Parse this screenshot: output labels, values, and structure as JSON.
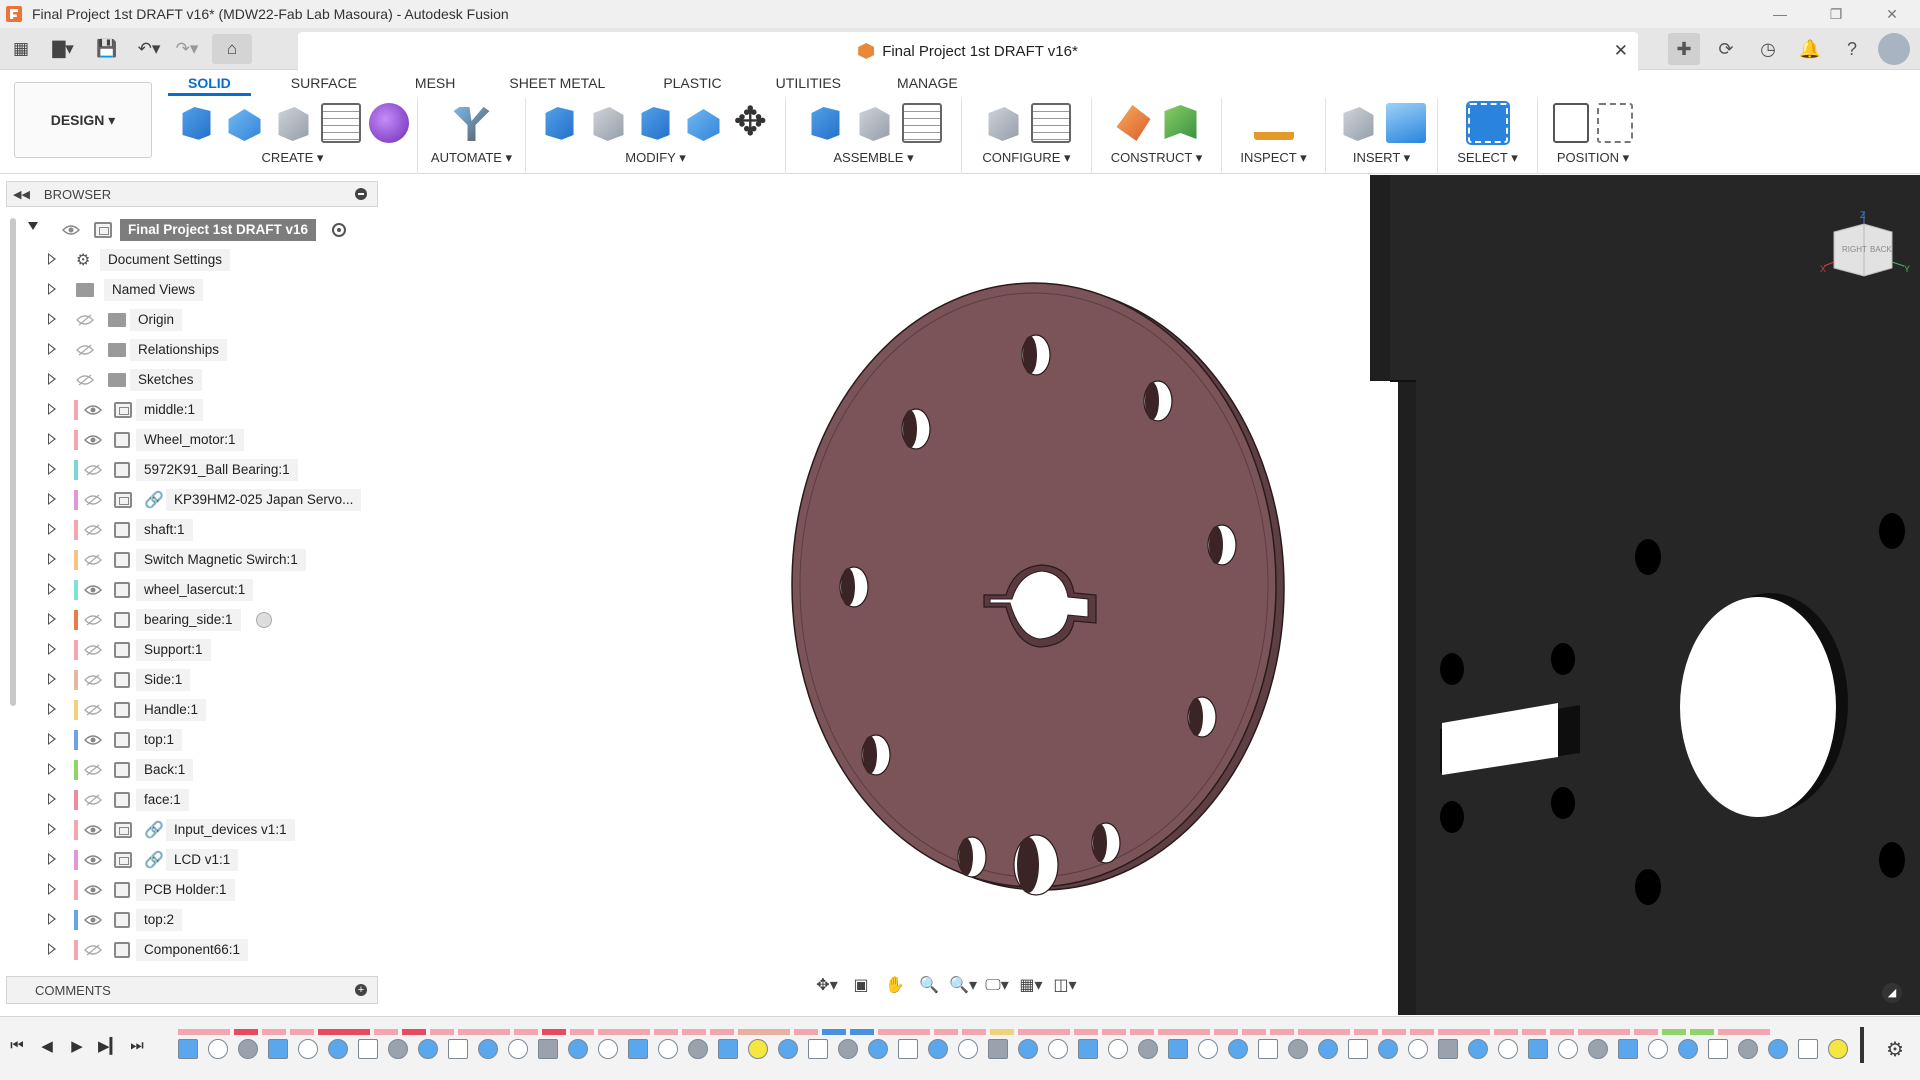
{
  "window": {
    "title": "Final Project 1st DRAFT v16* (MDW22-Fab Lab Masoura) - Autodesk Fusion",
    "controls": [
      "minimize-icon",
      "restore-icon",
      "close-icon"
    ]
  },
  "document_tab": {
    "title": "Final Project 1st DRAFT v16*",
    "close_glyph": "✕"
  },
  "ribbon": {
    "workspace_label": "DESIGN ▾",
    "tabs": [
      "SOLID",
      "SURFACE",
      "MESH",
      "SHEET METAL",
      "PLASTIC",
      "UTILITIES",
      "MANAGE"
    ],
    "active_tab": "SOLID",
    "groups": [
      {
        "label": "CREATE ▾",
        "icons": [
          "new-component-icon",
          "extrude-icon",
          "revolve-icon",
          "sketch-dimension-icon",
          "form-icon"
        ]
      },
      {
        "label": "AUTOMATE ▾",
        "icons": [
          "automate-icon"
        ]
      },
      {
        "label": "MODIFY ▾",
        "icons": [
          "press-pull-icon",
          "fillet-icon",
          "combine-icon",
          "offset-face-icon",
          "move-icon"
        ]
      },
      {
        "label": "ASSEMBLE ▾",
        "icons": [
          "new-component-icon",
          "joint-icon",
          "bom-icon"
        ]
      },
      {
        "label": "CONFIGURE ▾",
        "icons": [
          "configure-icon",
          "table-icon"
        ]
      },
      {
        "label": "CONSTRUCT ▾",
        "icons": [
          "offset-plane-icon",
          "midplane-icon"
        ]
      },
      {
        "label": "INSPECT ▾",
        "icons": [
          "measure-icon"
        ]
      },
      {
        "label": "INSERT ▾",
        "icons": [
          "insert-derive-icon",
          "insert-image-icon"
        ]
      },
      {
        "label": "SELECT ▾",
        "icons": [
          "select-icon"
        ]
      },
      {
        "label": "POSITION ▾",
        "icons": [
          "capture-position-icon",
          "revert-position-icon"
        ]
      }
    ]
  },
  "browser": {
    "title": "BROWSER",
    "root": {
      "label": "Final Project 1st DRAFT v16"
    },
    "items": [
      {
        "label": "Document Settings",
        "kind": "settings",
        "color": null,
        "visible": null
      },
      {
        "label": "Named Views",
        "kind": "folder",
        "color": null,
        "visible": null
      },
      {
        "label": "Origin",
        "kind": "folder",
        "color": null,
        "visible": false
      },
      {
        "label": "Relationships",
        "kind": "folder",
        "color": null,
        "visible": false
      },
      {
        "label": "Sketches",
        "kind": "folder",
        "color": null,
        "visible": false
      },
      {
        "label": "middle:1",
        "kind": "component-assembly",
        "color": "#f4a6b0",
        "visible": true
      },
      {
        "label": "Wheel_motor:1",
        "kind": "component",
        "color": "#f4a6b0",
        "visible": true
      },
      {
        "label": "5972K91_Ball Bearing:1",
        "kind": "component",
        "color": "#7fd6d0",
        "visible": false
      },
      {
        "label": "KP39HM2-025 Japan Servo...",
        "kind": "component-linked",
        "color": "#e596d6",
        "visible": false
      },
      {
        "label": "shaft:1",
        "kind": "component",
        "color": "#f4a6b0",
        "visible": false
      },
      {
        "label": "Switch Magnetic Swirch:1",
        "kind": "component",
        "color": "#f5c28a",
        "visible": false
      },
      {
        "label": "wheel_lasercut:1",
        "kind": "component",
        "color": "#7fe0d8",
        "visible": true
      },
      {
        "label": "bearing_side:1",
        "kind": "component",
        "color": "#ea7b4e",
        "visible": false,
        "radio": true
      },
      {
        "label": "Support:1",
        "kind": "component",
        "color": "#f4a6b0",
        "visible": false
      },
      {
        "label": "Side:1",
        "kind": "component",
        "color": "#e8b8a0",
        "visible": false
      },
      {
        "label": "Handle:1",
        "kind": "component",
        "color": "#f0d27a",
        "visible": false
      },
      {
        "label": "top:1",
        "kind": "component",
        "color": "#6aa3e6",
        "visible": true
      },
      {
        "label": "Back:1",
        "kind": "component",
        "color": "#8fd46a",
        "visible": false
      },
      {
        "label": "face:1",
        "kind": "component",
        "color": "#f08a9e",
        "visible": false
      },
      {
        "label": "Input_devices v1:1",
        "kind": "component-linked",
        "color": "#f4a6b0",
        "visible": true
      },
      {
        "label": "LCD v1:1",
        "kind": "component-linked",
        "color": "#e596d6",
        "visible": true
      },
      {
        "label": "PCB Holder:1",
        "kind": "component",
        "color": "#f4a6b0",
        "visible": true
      },
      {
        "label": "top:2",
        "kind": "component",
        "color": "#6aa3e6",
        "visible": true
      },
      {
        "label": "Component66:1",
        "kind": "component",
        "color": "#f4a6b0",
        "visible": false
      }
    ]
  },
  "comments": {
    "title": "COMMENTS"
  },
  "viewcube": {
    "face_right": "RIGHT",
    "face_back": "BACK",
    "axis_x": "X",
    "axis_y": "Y",
    "axis_z": "Z"
  },
  "colors": {
    "accent": "#0b6ccf",
    "disc_face": "#7a5458",
    "disc_edge": "#5e3f43",
    "panel": "#262626"
  },
  "timeline": {
    "controls": [
      "first-icon",
      "previous-icon",
      "play-icon",
      "next-icon",
      "last-icon"
    ],
    "feature_count": 56
  }
}
